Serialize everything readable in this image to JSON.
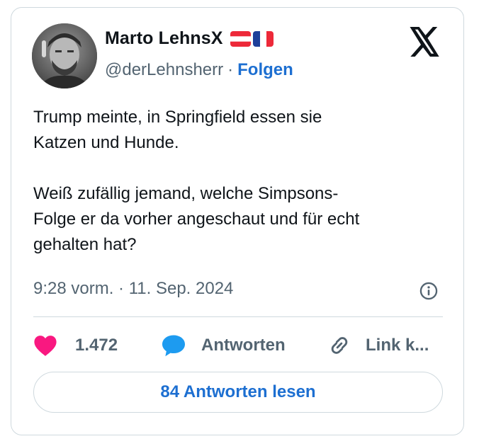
{
  "author": {
    "name": "Marto LehnsX",
    "handle": "@derLehnsherr",
    "separator": "·",
    "follow_label": "Folgen",
    "flag_icons": [
      "austria-flag-icon",
      "france-flag-icon"
    ]
  },
  "tweet": {
    "paragraphs": [
      [
        "Trump meinte, in Springfield essen sie",
        "Katzen und Hunde."
      ],
      [
        "Weiß zufällig jemand, welche Simpsons-",
        "Folge er da vorher angeschaut und für echt",
        "gehalten hat?"
      ]
    ],
    "timestamp": "9:28 vorm. · 11. Sep. 2024"
  },
  "actions": {
    "likes": "1.472",
    "reply_label": "Antworten",
    "link_label": "Link k..."
  },
  "read_replies_label": "84 Antworten lesen",
  "colors": {
    "heart": "#f91880",
    "reply_bubble": "#1d9bf0",
    "link_blue": "#1d6fd1",
    "muted": "#536471",
    "border": "#cfd9de"
  }
}
